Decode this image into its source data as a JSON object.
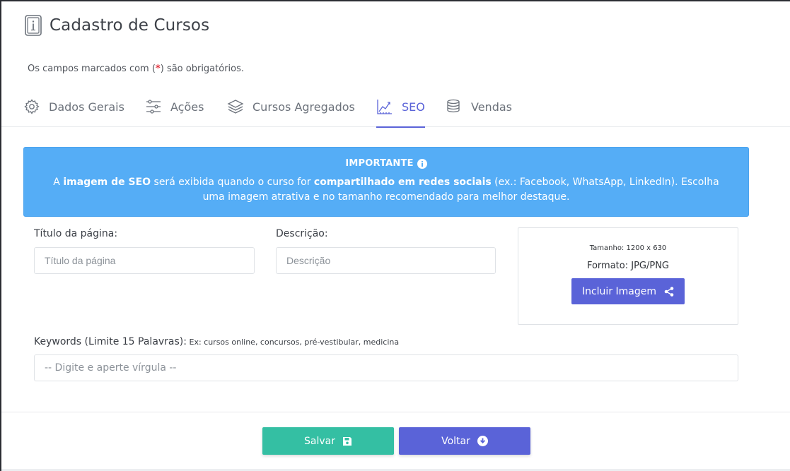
{
  "header": {
    "title": "Cadastro de Cursos"
  },
  "required_note": {
    "prefix": "Os campos marcados com (",
    "star": "*",
    "suffix": ") são obrigatórios."
  },
  "tabs": [
    {
      "label": "Dados Gerais",
      "icon": "gear-icon",
      "active": false
    },
    {
      "label": "Ações",
      "icon": "sliders-icon",
      "active": false
    },
    {
      "label": "Cursos Agregados",
      "icon": "layers-icon",
      "active": false
    },
    {
      "label": "SEO",
      "icon": "chart-line-icon",
      "active": true
    },
    {
      "label": "Vendas",
      "icon": "coins-icon",
      "active": false
    }
  ],
  "alert": {
    "title": "IMPORTANTE",
    "t1": "A ",
    "b1": "imagem de SEO",
    "t2": " será exibida quando o curso for ",
    "b2": "compartilhado em redes sociais",
    "t3": " (ex.: Facebook, WhatsApp, LinkedIn). Escolha uma imagem atrativa e no tamanho recomendado para melhor destaque."
  },
  "form": {
    "title_label": "Título da página:",
    "title_placeholder": "Título da página",
    "title_value": "",
    "description_label": "Descrição:",
    "description_placeholder": "Descrição",
    "description_value": "",
    "keywords_label": "Keywords (Limite 15 Palavras):",
    "keywords_hint": " Ex: cursos online, concursos, pré-vestibular, medicina",
    "keywords_placeholder": "-- Digite e aperte vírgula --",
    "keywords_value": ""
  },
  "image_box": {
    "size": "Tamanho: 1200 x 630",
    "format": "Formato: JPG/PNG",
    "button_label": "Incluir Imagem"
  },
  "footer": {
    "save_label": "Salvar",
    "back_label": "Voltar"
  },
  "colors": {
    "primary": "#5a63d8",
    "success": "#34bfa3",
    "info": "#55adf6"
  }
}
